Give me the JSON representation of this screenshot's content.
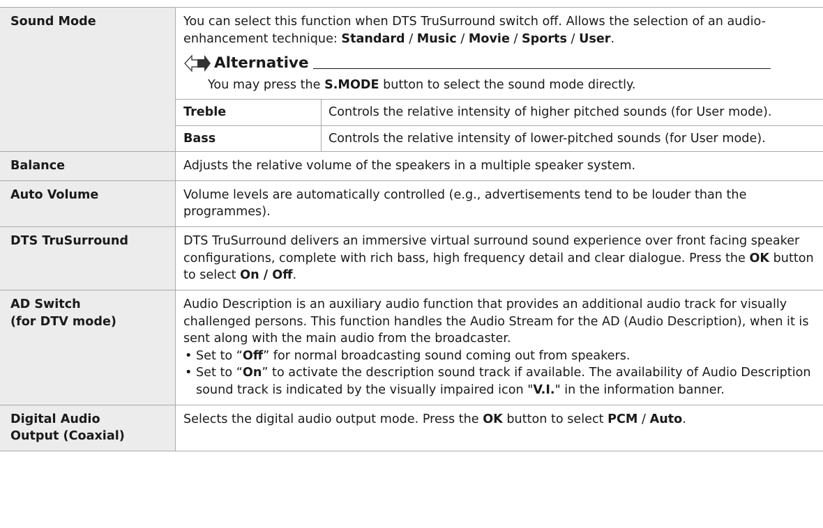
{
  "rows": {
    "sound_mode": {
      "label": "Sound Mode",
      "desc_pre": "You can select this function when DTS TruSurround switch off. Allows the selection of an audio-enhancement technique: ",
      "modes": [
        "Standard",
        "Music",
        "Movie",
        "Sports",
        "User"
      ],
      "separator": " / ",
      "end": ".",
      "alternative": {
        "title": "Alternative",
        "pre": "You may press the ",
        "button": "S.MODE",
        "post": " button to select the sound mode directly."
      },
      "sub": [
        {
          "label": "Treble",
          "desc": "Controls the relative intensity of higher pitched sounds (for User mode)."
        },
        {
          "label": "Bass",
          "desc": "Controls the relative intensity of lower-pitched sounds (for User mode)."
        }
      ]
    },
    "balance": {
      "label": "Balance",
      "desc": "Adjusts the relative volume of the speakers in a multiple speaker system."
    },
    "auto_volume": {
      "label": "Auto Volume",
      "desc": "Volume levels are automatically controlled (e.g., advertisements tend to be louder than the programmes)."
    },
    "dts": {
      "label": "DTS TruSurround",
      "desc_pre": "DTS TruSurround delivers an immersive virtual surround sound experience over front facing speaker configurations, complete with rich bass, high frequency detail and clear dialogue. Press the ",
      "ok": "OK",
      "mid": " button to select ",
      "onoff": "On / Off",
      "end": "."
    },
    "ad_switch": {
      "label_line1": "AD Switch",
      "label_line2": "(for DTV mode)",
      "desc": "Audio Description is an auxiliary audio function that provides an additional audio track for visually challenged persons. This function handles the Audio Stream for the AD (Audio Description), when it is sent along with the main audio from the broadcaster.",
      "bullet_symbol": "•",
      "b1_pre": "Set to “",
      "b1_em": "Off",
      "b1_post": "” for normal broadcasting sound coming out from speakers.",
      "b2_pre": "Set to “",
      "b2_em": "On",
      "b2_post": "” to activate the description sound track if available. The availability of Audio Description sound track is indicated by the visually impaired icon \"",
      "b2_em2": "V.I.",
      "b2_post2": "\" in the information banner."
    },
    "digital_audio": {
      "label_line1": "Digital Audio",
      "label_line2": "Output (Coaxial)",
      "desc_pre": "Selects the digital audio output mode. Press the ",
      "ok": "OK",
      "mid": " button to select ",
      "pcm": "PCM",
      "sep": " / ",
      "auto": "Auto",
      "end": "."
    }
  }
}
